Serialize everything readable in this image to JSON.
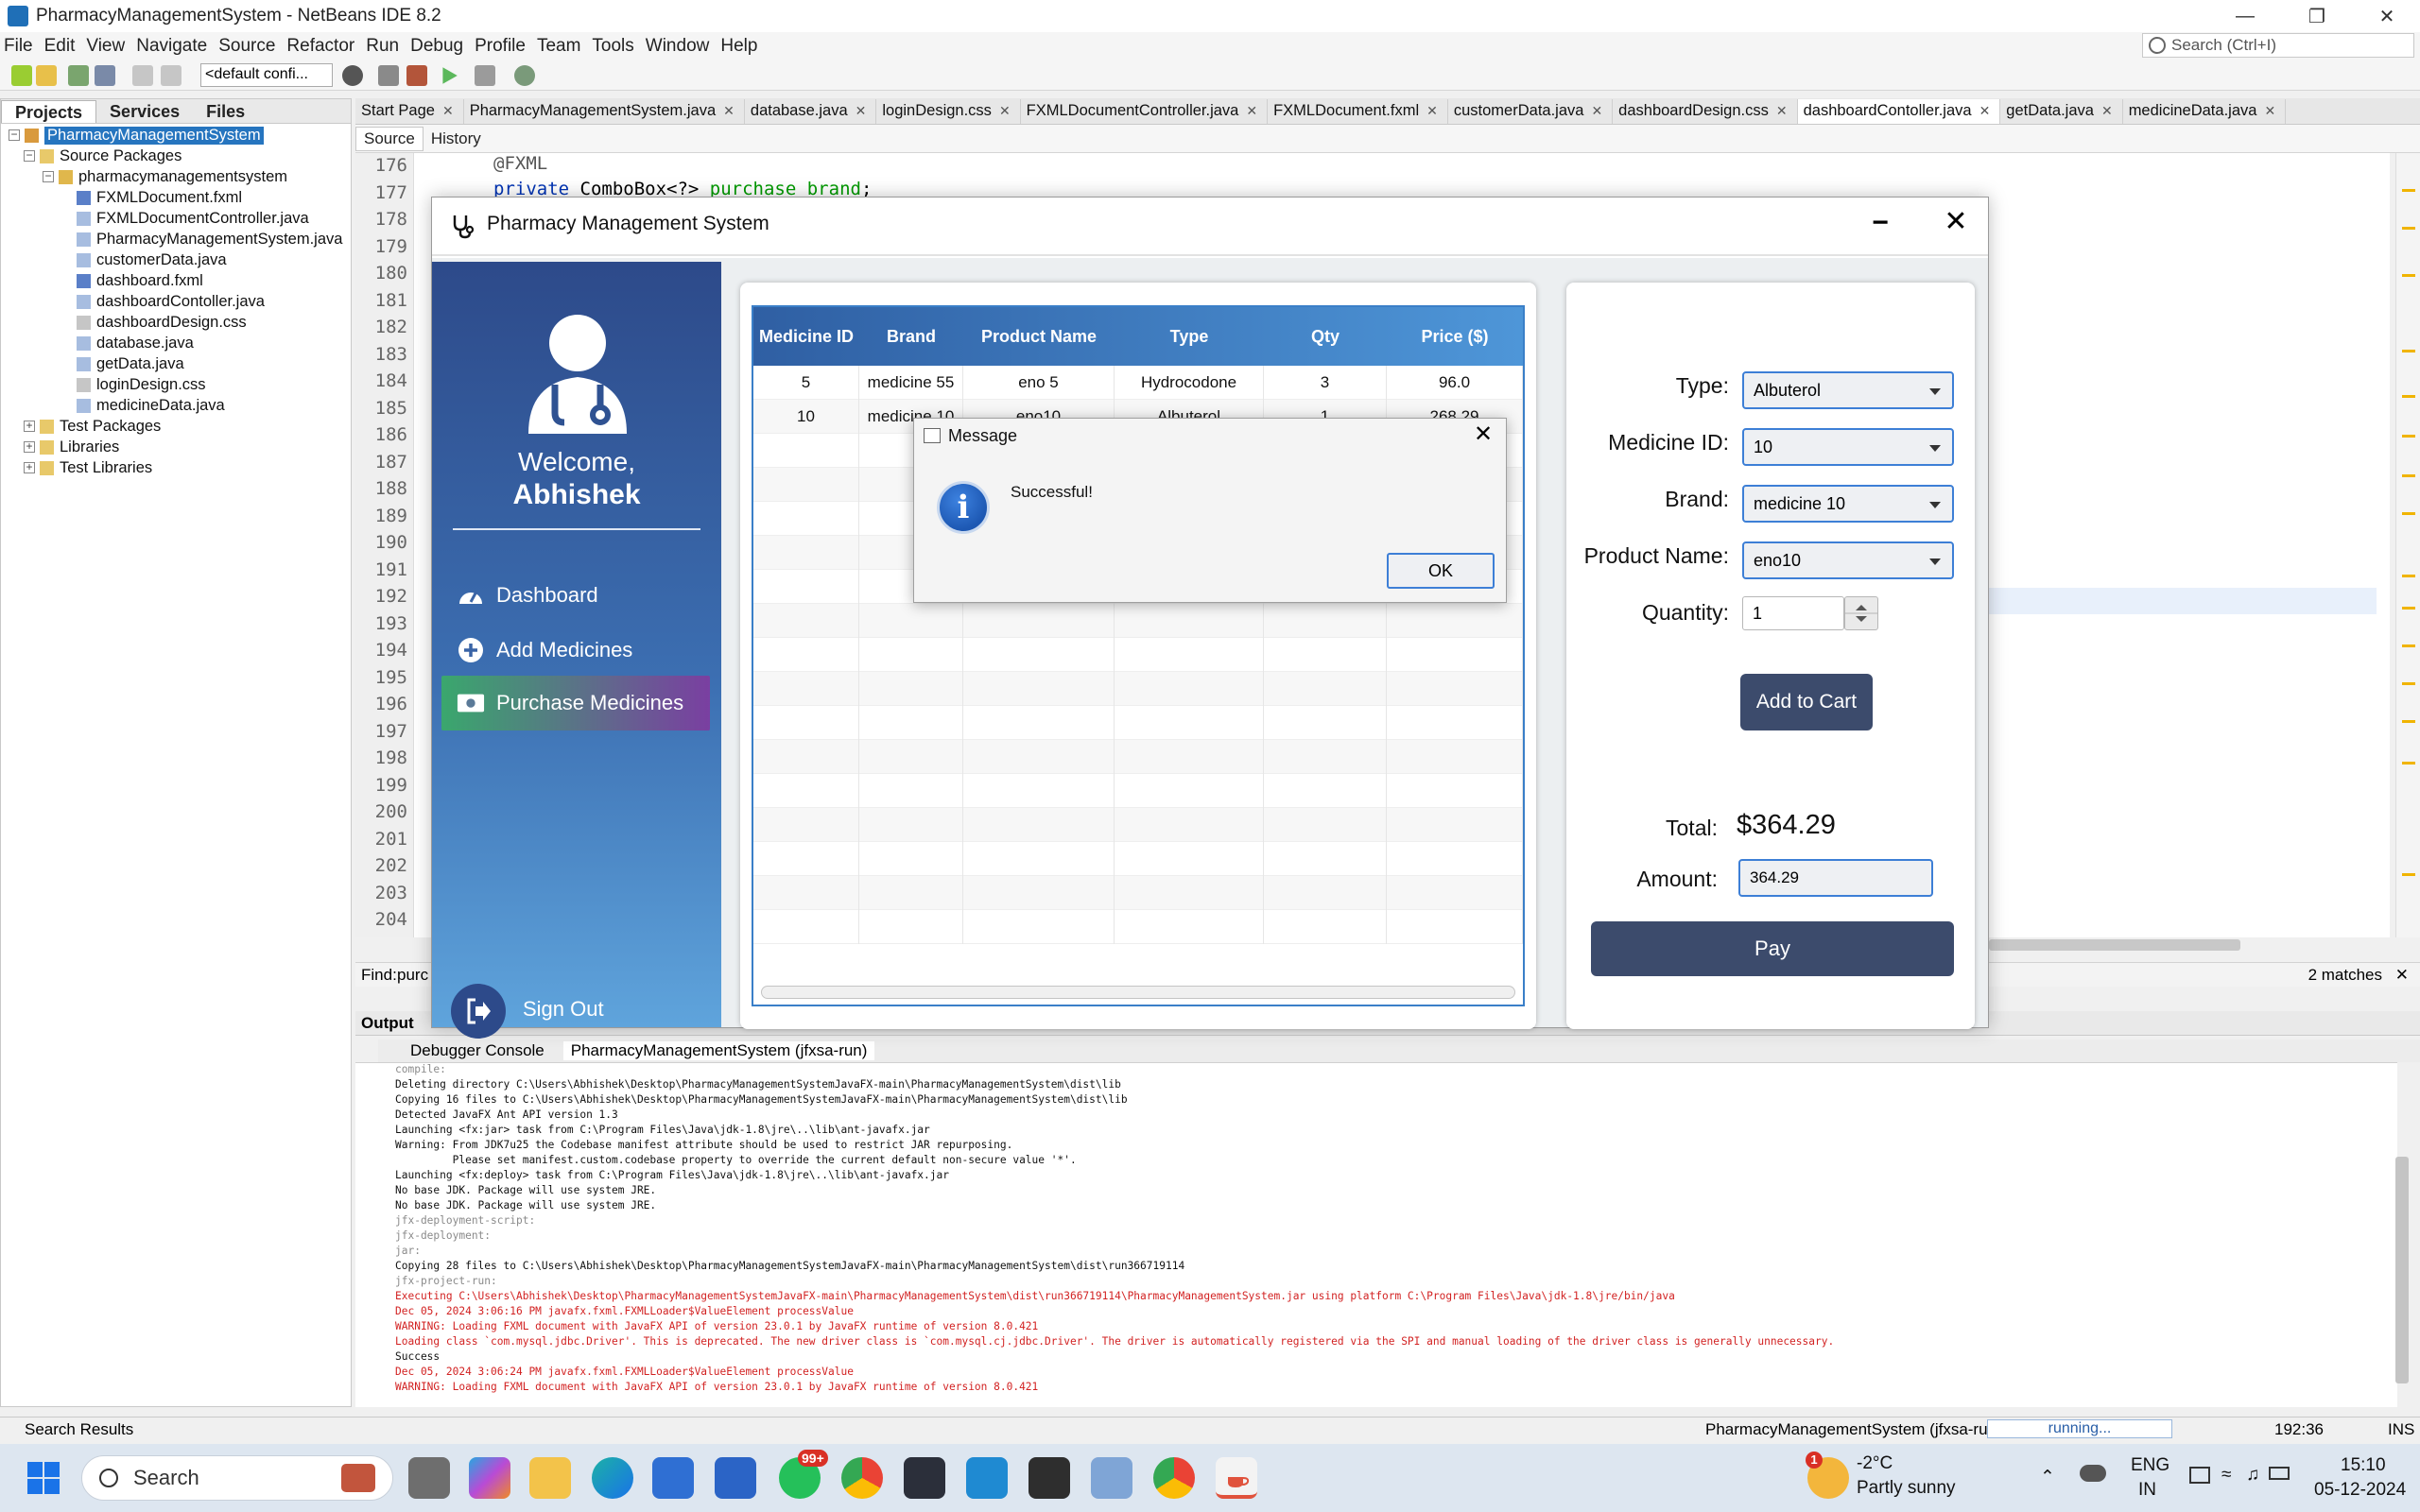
{
  "window": {
    "title": "PharmacyManagementSystem - NetBeans IDE 8.2"
  },
  "menu": [
    "File",
    "Edit",
    "View",
    "Navigate",
    "Source",
    "Refactor",
    "Run",
    "Debug",
    "Profile",
    "Team",
    "Tools",
    "Window",
    "Help"
  ],
  "search": {
    "placeholder": "Search (Ctrl+I)"
  },
  "toolbar": {
    "config": "<default confi..."
  },
  "projects_panel": {
    "tabs": [
      "Projects",
      "Services",
      "Files"
    ],
    "tree": [
      "PharmacyManagementSystem",
      "Source Packages",
      "pharmacymanagementsystem",
      "FXMLDocument.fxml",
      "FXMLDocumentController.java",
      "PharmacyManagementSystem.java",
      "customerData.java",
      "dashboard.fxml",
      "dashboardContoller.java",
      "dashboardDesign.css",
      "database.java",
      "getData.java",
      "loginDesign.css",
      "medicineData.java",
      "Test Packages",
      "Libraries",
      "Test Libraries"
    ]
  },
  "editor": {
    "tabs": [
      "Start Page",
      "PharmacyManagementSystem.java",
      "database.java",
      "loginDesign.css",
      "FXMLDocumentController.java",
      "FXMLDocument.fxml",
      "customerData.java",
      "dashboardDesign.css",
      "dashboardContoller.java",
      "getData.java",
      "medicineData.java"
    ],
    "active_tab": "dashboardContoller.java",
    "subtabs": [
      "Source",
      "History"
    ],
    "line_numbers": [
      "176",
      "177",
      "178",
      "179",
      "180",
      "181",
      "182",
      "183",
      "184",
      "185",
      "186",
      "187",
      "188",
      "189",
      "190",
      "191",
      "192",
      "193",
      "194",
      "195",
      "196",
      "197",
      "198",
      "199",
      "200",
      "201",
      "202",
      "203",
      "204"
    ],
    "code_line_1": "@FXML",
    "code_line_2_kw": "private",
    "code_line_2_type": " ComboBox<?> ",
    "code_line_2_var": "purchase_brand",
    "code_line_2_end": ";"
  },
  "find": {
    "label": "Find:",
    "value": "purc",
    "matches": "2 matches"
  },
  "output": {
    "title": "Output",
    "tabs": [
      "Debugger Console",
      "PharmacyManagementSystem (jfxsa-run)"
    ],
    "lines": [
      {
        "t": "compile:",
        "c": "gray"
      },
      {
        "t": "Deleting directory C:\\Users\\Abhishek\\Desktop\\PharmacyManagementSystemJavaFX-main\\PharmacyManagementSystem\\dist\\lib",
        "c": ""
      },
      {
        "t": "Copying 16 files to C:\\Users\\Abhishek\\Desktop\\PharmacyManagementSystemJavaFX-main\\PharmacyManagementSystem\\dist\\lib",
        "c": ""
      },
      {
        "t": "Detected JavaFX Ant API version 1.3",
        "c": ""
      },
      {
        "t": "Launching <fx:jar> task from C:\\Program Files\\Java\\jdk-1.8\\jre\\..\\lib\\ant-javafx.jar",
        "c": ""
      },
      {
        "t": "Warning: From JDK7u25 the Codebase manifest attribute should be used to restrict JAR repurposing.",
        "c": ""
      },
      {
        "t": "         Please set manifest.custom.codebase property to override the current default non-secure value '*'.",
        "c": ""
      },
      {
        "t": "Launching <fx:deploy> task from C:\\Program Files\\Java\\jdk-1.8\\jre\\..\\lib\\ant-javafx.jar",
        "c": ""
      },
      {
        "t": "No base JDK. Package will use system JRE.",
        "c": ""
      },
      {
        "t": "No base JDK. Package will use system JRE.",
        "c": ""
      },
      {
        "t": "jfx-deployment-script:",
        "c": "gray"
      },
      {
        "t": "jfx-deployment:",
        "c": "gray"
      },
      {
        "t": "jar:",
        "c": "gray"
      },
      {
        "t": "Copying 28 files to C:\\Users\\Abhishek\\Desktop\\PharmacyManagementSystemJavaFX-main\\PharmacyManagementSystem\\dist\\run366719114",
        "c": ""
      },
      {
        "t": "jfx-project-run:",
        "c": "gray"
      },
      {
        "t": "Executing C:\\Users\\Abhishek\\Desktop\\PharmacyManagementSystemJavaFX-main\\PharmacyManagementSystem\\dist\\run366719114\\PharmacyManagementSystem.jar using platform C:\\Program Files\\Java\\jdk-1.8\\jre/bin/java",
        "c": "red"
      },
      {
        "t": "Dec 05, 2024 3:06:16 PM javafx.fxml.FXMLLoader$ValueElement processValue",
        "c": "red"
      },
      {
        "t": "WARNING: Loading FXML document with JavaFX API of version 23.0.1 by JavaFX runtime of version 8.0.421",
        "c": "red"
      },
      {
        "t": "Loading class `com.mysql.jdbc.Driver'. This is deprecated. The new driver class is `com.mysql.cj.jdbc.Driver'. The driver is automatically registered via the SPI and manual loading of the driver class is generally unnecessary.",
        "c": "red"
      },
      {
        "t": "Success",
        "c": ""
      },
      {
        "t": "Dec 05, 2024 3:06:24 PM javafx.fxml.FXMLLoader$ValueElement processValue",
        "c": "red"
      },
      {
        "t": "WARNING: Loading FXML document with JavaFX API of version 23.0.1 by JavaFX runtime of version 8.0.421",
        "c": "red"
      }
    ]
  },
  "statusbar": {
    "left": "Search Results",
    "run_label": "PharmacyManagementSystem (jfxsa-run)",
    "progress": "running...",
    "position": "192:36",
    "mode": "INS"
  },
  "app": {
    "title": "Pharmacy Management System",
    "min": "−",
    "close": "✕",
    "welcome": "Welcome,",
    "username": "Abhishek",
    "nav": [
      "Dashboard",
      "Add Medicines",
      "Purchase Medicines"
    ],
    "signout": "Sign Out",
    "table": {
      "headers": [
        "Medicine ID",
        "Brand",
        "Product Name",
        "Type",
        "Qty",
        "Price ($)"
      ],
      "rows": [
        [
          "5",
          "medicine 55",
          "eno 5",
          "Hydrocodone",
          "3",
          "96.0"
        ],
        [
          "10",
          "medicine 10",
          "eno10",
          "Albuterol",
          "1",
          "268.29"
        ]
      ]
    },
    "form": {
      "type_label": "Type:",
      "type_value": "Albuterol",
      "id_label": "Medicine ID:",
      "id_value": "10",
      "brand_label": "Brand:",
      "brand_value": "medicine 10",
      "product_label": "Product Name:",
      "product_value": "eno10",
      "qty_label": "Quantity:",
      "qty_value": "1",
      "add_to_cart": "Add to Cart",
      "total_label": "Total:",
      "total_value": "$364.29",
      "amount_label": "Amount:",
      "amount_value": "364.29",
      "pay": "Pay"
    }
  },
  "dialog": {
    "title": "Message",
    "message": "Successful!",
    "ok": "OK",
    "close": "✕"
  },
  "taskbar": {
    "search": "Search",
    "whatsapp_badge": "99+",
    "weather_temp": "-2°C",
    "weather_desc": "Partly sunny",
    "weather_badge": "1",
    "lang_1": "ENG",
    "lang_2": "IN",
    "time": "15:10",
    "date": "05-12-2024"
  }
}
